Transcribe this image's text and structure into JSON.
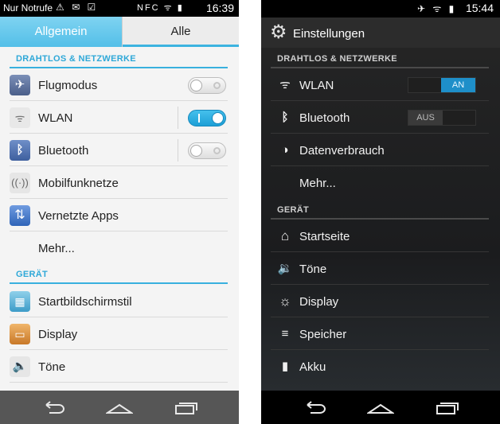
{
  "left": {
    "status_bar": {
      "carrier": "Nur Notrufe",
      "time": "16:39",
      "left_icons": "⚠ ✉ ☑",
      "right_icons": "NFC ᯤ ▮"
    },
    "tabs": [
      {
        "label": "Allgemein"
      },
      {
        "label": "Alle"
      }
    ],
    "sections": [
      {
        "title": "DRAHTLOS & NETZWERKE"
      },
      {
        "title": "GERÄT"
      }
    ],
    "items": [
      {
        "label": "Flugmodus",
        "icon": "airplane-icon",
        "toggle": false
      },
      {
        "label": "WLAN",
        "icon": "wifi-icon",
        "toggle": true
      },
      {
        "label": "Bluetooth",
        "icon": "bluetooth-icon",
        "toggle": false
      },
      {
        "label": "Mobilfunknetze",
        "icon": "mobile-network-icon"
      },
      {
        "label": "Vernetzte Apps",
        "icon": "connected-apps-icon"
      },
      {
        "label": "Mehr..."
      },
      {
        "label": "Startbildschirmstil",
        "icon": "home-style-icon"
      },
      {
        "label": "Display",
        "icon": "display-icon"
      },
      {
        "label": "Töne",
        "icon": "sound-icon"
      }
    ],
    "colors": {
      "accent": "#39b0de",
      "tab_active": "#53bfe8"
    }
  },
  "right": {
    "status_bar": {
      "time": "15:44",
      "icons": "✈ ᯤ ▮"
    },
    "action_bar": {
      "title": "Einstellungen",
      "icon": "gear-icon"
    },
    "sections": [
      {
        "title": "DRAHTLOS & NETZWERKE"
      },
      {
        "title": "GERÄT"
      }
    ],
    "items": [
      {
        "label": "WLAN",
        "icon": "wifi-icon",
        "toggle_label": "AN"
      },
      {
        "label": "Bluetooth",
        "icon": "bluetooth-icon",
        "toggle_label": "AUS"
      },
      {
        "label": "Datenverbrauch",
        "icon": "data-usage-icon"
      },
      {
        "label": "Mehr..."
      },
      {
        "label": "Startseite",
        "icon": "home-icon"
      },
      {
        "label": "Töne",
        "icon": "speaker-icon"
      },
      {
        "label": "Display",
        "icon": "brightness-icon"
      },
      {
        "label": "Speicher",
        "icon": "storage-icon"
      },
      {
        "label": "Akku",
        "icon": "battery-icon"
      }
    ],
    "colors": {
      "toggle_on": "#1e8fc9"
    }
  }
}
